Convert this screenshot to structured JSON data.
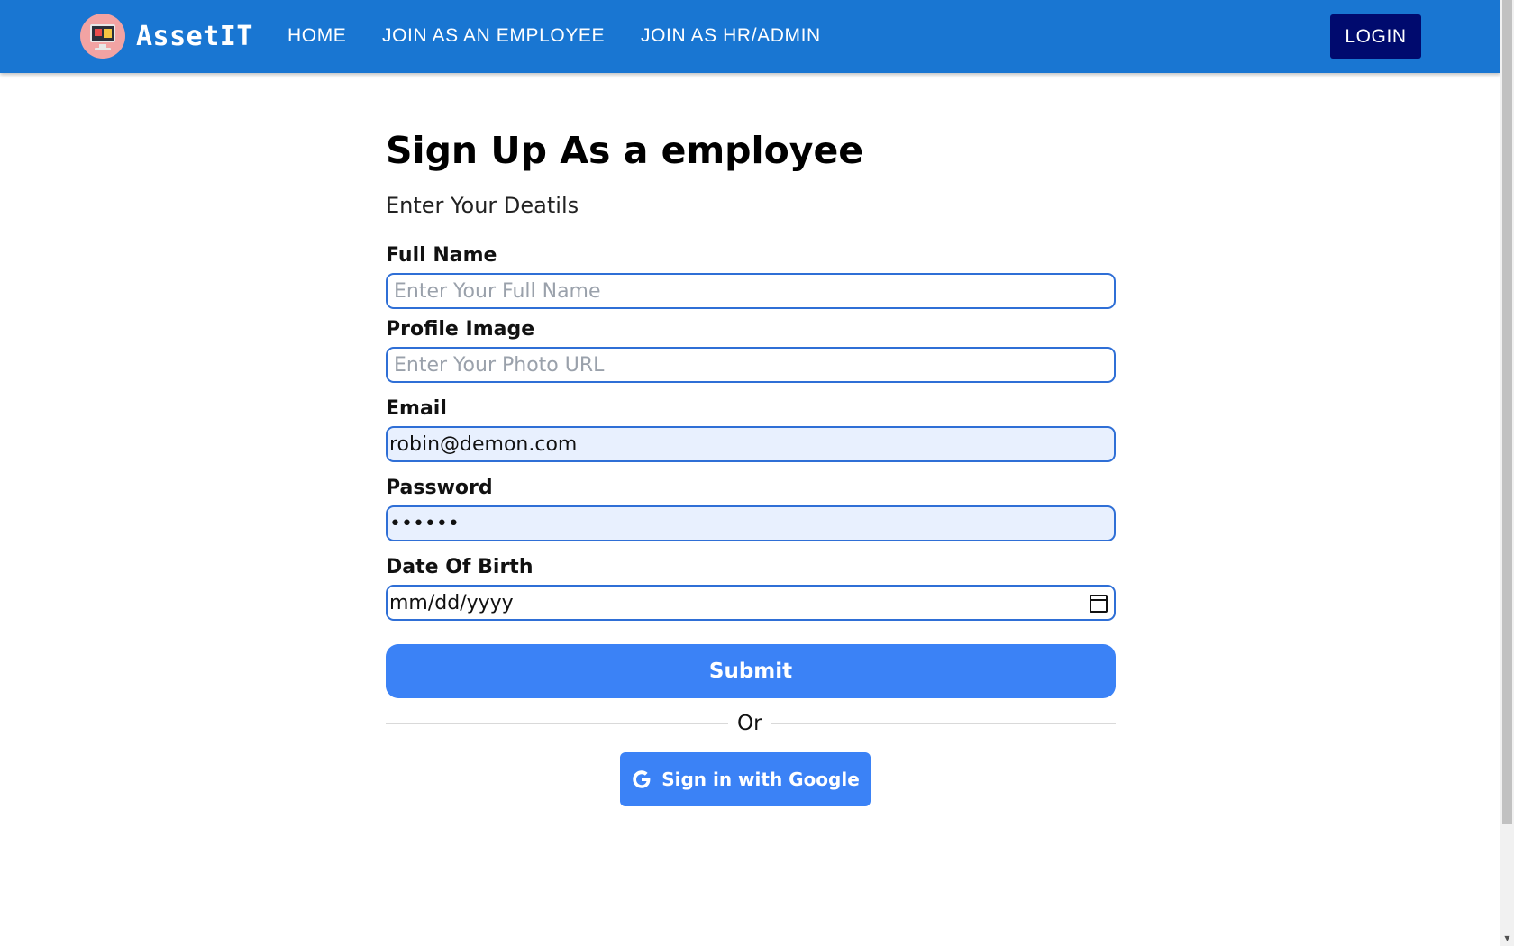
{
  "navbar": {
    "brand": "AssetIT",
    "links": [
      "HOME",
      "JOIN AS AN EMPLOYEE",
      "JOIN AS HR/ADMIN"
    ],
    "login_label": "LOGIN",
    "bg_color": "#1976d2",
    "login_color": "#000a6e",
    "logo_icon": "computer-monitor-icon"
  },
  "form": {
    "title": "Sign Up As a employee",
    "subtitle": "Enter Your Deatils",
    "full_name": {
      "label": "Full Name",
      "placeholder": "Enter Your Full Name",
      "value": ""
    },
    "profile_image": {
      "label": "Profile Image",
      "placeholder": "Enter Your Photo URL",
      "value": ""
    },
    "email": {
      "label": "Email",
      "value": "robin@demon.com"
    },
    "password": {
      "label": "Password",
      "value": "••••••"
    },
    "dob": {
      "label": "Date Of Birth",
      "value": "mm/dd/yyyy",
      "icon": "calendar-icon"
    },
    "submit_label": "Submit",
    "or_label": "Or",
    "google_label": "Sign in with Google",
    "accent_color": "#3b82f6"
  }
}
